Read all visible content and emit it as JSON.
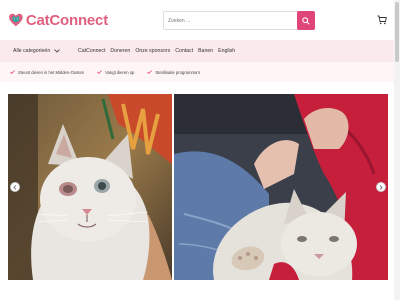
{
  "brand": {
    "name_part1": "Cat",
    "name_part2": "Connect",
    "accent": "#e0607e",
    "search_button_color": "#e0457a"
  },
  "search": {
    "placeholder": "Zoeken ...",
    "icon": "search-icon"
  },
  "header": {
    "cart_icon": "cart-icon"
  },
  "nav": {
    "categories_label": "Alle categorieën",
    "items": [
      "CatConnect",
      "Doneren",
      "Onze sponsors",
      "Contact",
      "Banen",
      "English"
    ]
  },
  "usp": {
    "items": [
      "Steunt dieren in het Midden-Oosten",
      "Vangt dieren op",
      "Sterilisatie programma's"
    ]
  },
  "hero": {
    "images": [
      "white-kitten-with-eye-infection",
      "white-cat-held-in-arms"
    ]
  }
}
